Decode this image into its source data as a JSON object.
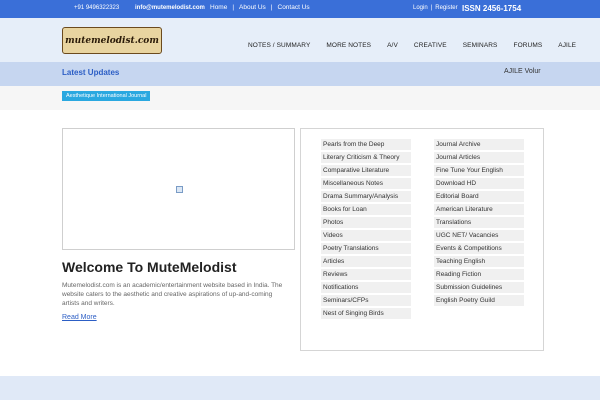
{
  "topbar": {
    "phone": "+91 9496322323",
    "email": "info@mutemelodist.com",
    "nav": [
      "Home",
      "About Us",
      "Contact Us"
    ],
    "login": "Login",
    "register": "Register",
    "issn": "ISSN 2456-1754"
  },
  "header": {
    "logo_text": "mutemelodist.com",
    "nav": [
      "NOTES / SUMMARY",
      "MORE NOTES",
      "A/V",
      "CREATIVE",
      "SEMINARS",
      "FORUMS",
      "AJILE"
    ]
  },
  "updates": {
    "title": "Latest Updates",
    "ticker": "AJILE Volur"
  },
  "tag": "Aesthetique International Journal",
  "main": {
    "welcome": "Welcome To MuteMelodist",
    "description": "Mutemelodist.com is an academic/entertainment website based in India. The website caters to the aesthetic and creative aspirations of up-and-coming artists and writers.",
    "read_more": "Read More"
  },
  "links": {
    "left": [
      "Pearls from the Deep",
      "Literary Criticism & Theory",
      "Comparative Literature",
      "Miscellaneous Notes",
      "Drama Summary/Analysis",
      "Books for Loan",
      "Photos",
      "Videos",
      "Poetry Translations",
      "Articles",
      "Reviews",
      "Notifications",
      "Seminars/CFPs",
      "Nest of Singing Birds"
    ],
    "right": [
      "Journal Archive",
      "Journal Articles",
      "Fine Tune Your English",
      "Download HD",
      "Editorial Board",
      "American Literature",
      "Translations",
      "UGC NET/ Vacancies",
      "Events & Competitions",
      "Teaching English",
      "Reading Fiction",
      "Submission Guidelines",
      "English Poetry Guild"
    ]
  },
  "colors": {
    "topbar": "#3a6fd8",
    "accent": "#2c5ec5",
    "tag": "#2aa8e0"
  }
}
